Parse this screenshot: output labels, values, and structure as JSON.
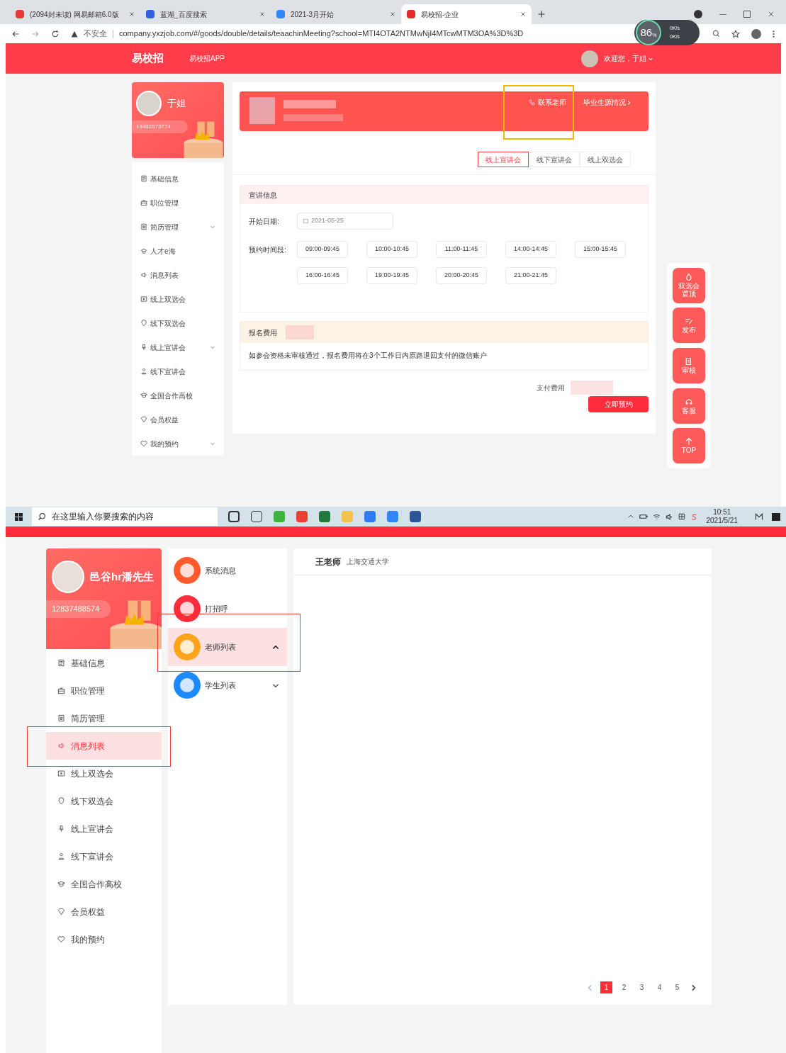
{
  "browser": {
    "tabs": [
      {
        "title": "(2094封未读) 网易邮箱6.0版",
        "selected": false
      },
      {
        "title": "蓝湖_百度搜索",
        "selected": false
      },
      {
        "title": "2021-3月开始",
        "selected": false
      },
      {
        "title": "易校招-企业",
        "selected": true
      }
    ],
    "security": "不安全",
    "url": "company.yxzjob.com/#/goods/double/details/teaachinMeeting?school=MTI4OTA2NTMwNjI4MTcwMTM3OA%3D%3D",
    "speed": {
      "percent": "86",
      "unit": "%",
      "up": "0K/s",
      "down": "0K/s"
    }
  },
  "top_page": {
    "header": {
      "brand": "易校招",
      "app_link": "易校招APP",
      "greeting": "欢迎您，于姐"
    },
    "profile": {
      "name": "于姐",
      "phone": "13482573774"
    },
    "sidebar": [
      {
        "label": "基础信息",
        "caret": false
      },
      {
        "label": "职位管理",
        "caret": false
      },
      {
        "label": "简历管理",
        "caret": true
      },
      {
        "label": "人才e海",
        "caret": false
      },
      {
        "label": "消息列表",
        "caret": false
      },
      {
        "label": "线上双选会",
        "caret": false
      },
      {
        "label": "线下双选会",
        "caret": false
      },
      {
        "label": "线上宣讲会",
        "caret": true
      },
      {
        "label": "线下宣讲会",
        "caret": false
      },
      {
        "label": "全国合作高校",
        "caret": false
      },
      {
        "label": "会员权益",
        "caret": false
      },
      {
        "label": "我的预约",
        "caret": true
      }
    ],
    "banner": {
      "contact": "联系老师",
      "graduates": "毕业生源情况"
    },
    "tabs": [
      {
        "label": "线上宣讲会",
        "selected": true
      },
      {
        "label": "线下宣讲会",
        "selected": false
      },
      {
        "label": "线上双选会",
        "selected": false
      }
    ],
    "info": {
      "title": "宣讲信息",
      "date_label": "开始日期:",
      "date": "2021-05-25",
      "slots_label": "预约时间段:",
      "slots": [
        "09:00-09:45",
        "10:00-10:45",
        "11:00-11:45",
        "14:00-14:45",
        "15:00-15:45",
        "16:00-16:45",
        "19:00-19:45",
        "20:00-20:45",
        "21:00-21:45"
      ]
    },
    "fee": {
      "title": "报名费用",
      "note": "如参会资格未审核通过，报名费用将在3个工作日内原路退回支付的微信账户",
      "pay_label": "支付费用",
      "button": "立即预约"
    },
    "tools": [
      "双选会置顶",
      "发布",
      "审核",
      "客服",
      "TOP"
    ]
  },
  "taskbar": {
    "search_placeholder": "在这里输入你要搜索的内容",
    "time": "10:51",
    "date": "2021/5/21"
  },
  "bottom_page": {
    "profile": {
      "name": "邑谷hr潘先生",
      "phone": "12837488574"
    },
    "sidebar": [
      {
        "label": "基础信息",
        "selected": false
      },
      {
        "label": "职位管理",
        "selected": false
      },
      {
        "label": "简历管理",
        "selected": false
      },
      {
        "label": "消息列表",
        "selected": true
      },
      {
        "label": "线上双选会",
        "selected": false
      },
      {
        "label": "线下双选会",
        "selected": false
      },
      {
        "label": "线上宣讲会",
        "selected": false
      },
      {
        "label": "线下宣讲会",
        "selected": false
      },
      {
        "label": "全国合作高校",
        "selected": false
      },
      {
        "label": "会员权益",
        "selected": false
      },
      {
        "label": "我的预约",
        "selected": false
      }
    ],
    "categories": [
      {
        "label": "系统消息",
        "color": "#ff5a2c",
        "selected": false
      },
      {
        "label": "打招呼",
        "color": "#ff2d3c",
        "selected": false
      },
      {
        "label": "老师列表",
        "color": "#ffa41b",
        "expanded": true,
        "selected": true
      },
      {
        "label": "学生列表",
        "color": "#1e88ff",
        "expanded": false,
        "selected": false
      }
    ],
    "chat": {
      "name": "王老师",
      "school": "上海交通大学"
    },
    "pages": [
      {
        "label": "1",
        "selected": true
      },
      {
        "label": "2",
        "selected": false
      },
      {
        "label": "3",
        "selected": false
      },
      {
        "label": "4",
        "selected": false
      },
      {
        "label": "5",
        "selected": false
      }
    ]
  }
}
